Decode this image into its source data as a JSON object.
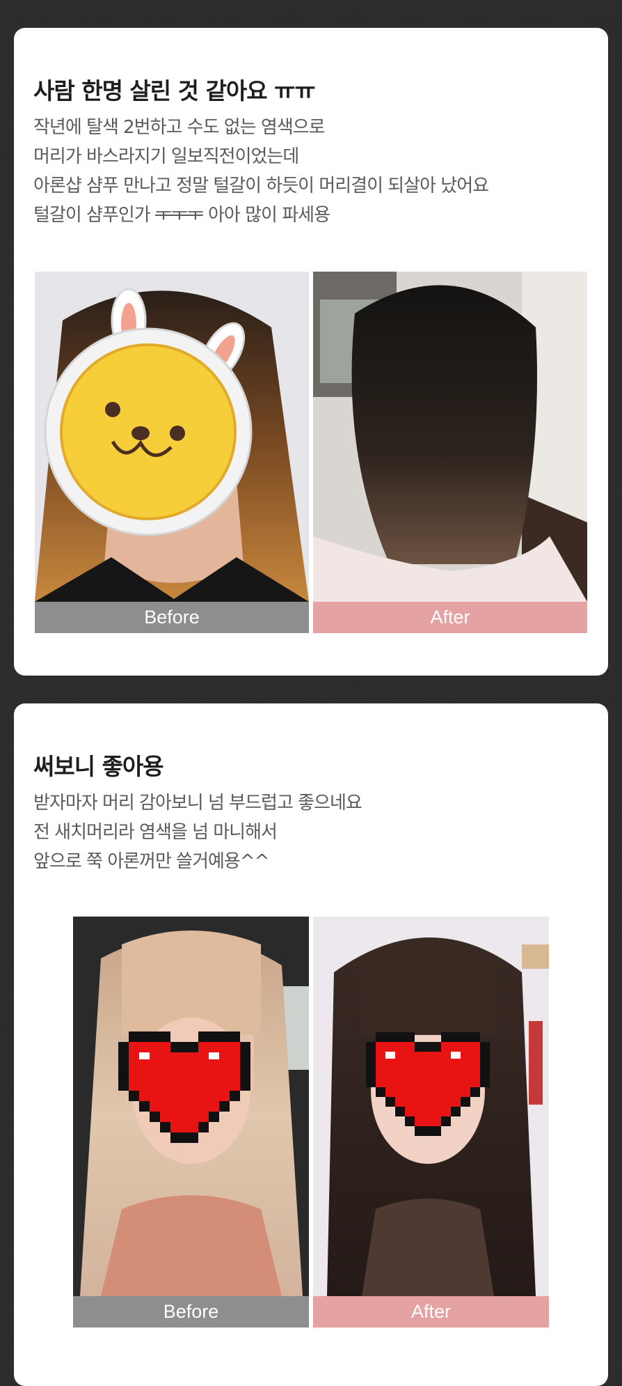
{
  "reviews": [
    {
      "title": "사람 한명 살린 것 같아요 ㅠㅠ",
      "lines": [
        "작년에 탈색 2번하고 수도 없는 염색으로",
        "머리가 바스라지기 일보직전이었는데",
        "아론샵 샴푸 만나고 정말 털갈이 하듯이 머리결이 되살아 났어요"
      ],
      "line4_prefix": "털갈이 샴푸인가 ",
      "line4_strike": "ㅜㅜㅜ",
      "line4_suffix": " 아아 많이 파세용",
      "before_label": "Before",
      "after_label": "After"
    },
    {
      "title": "써보니 좋아용",
      "lines": [
        "받자마자 머리 감아보니 넘 부드럽고 좋으네요",
        "전 새치머리라 염색을 넘 마니해서",
        "앞으로 쭉 아론꺼만 쓸거예용^^"
      ],
      "before_label": "Before",
      "after_label": "After"
    }
  ],
  "colors": {
    "background": "#2b2b2b",
    "card": "#ffffff",
    "before_caption": "#8e8e8e",
    "after_caption": "#e4a2a3"
  }
}
